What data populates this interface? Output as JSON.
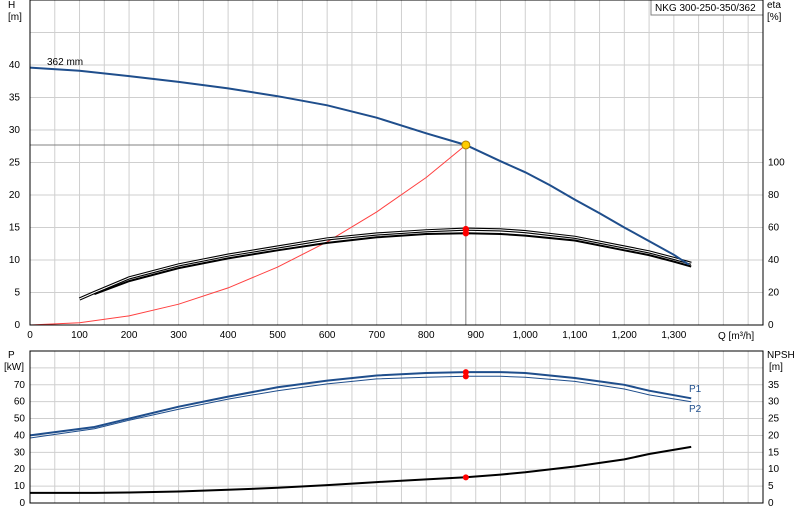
{
  "model_box": {
    "text": "NKG 300-250-350/362"
  },
  "top_chart": {
    "y_left_label": "H",
    "y_left_unit": "[m]",
    "y_right_label": "eta",
    "y_right_unit": "[%]",
    "x_label": "Q [m³/h]",
    "x_ticks": [
      "0",
      "100",
      "200",
      "300",
      "400",
      "500",
      "600",
      "700",
      "800",
      "900",
      "1,000",
      "1,100",
      "1,200",
      "1,300"
    ],
    "y_left_ticks": [
      "0",
      "5",
      "10",
      "15",
      "20",
      "25",
      "30",
      "35",
      "40"
    ],
    "y_right_ticks": [
      "0",
      "20",
      "40",
      "60",
      "80",
      "100"
    ],
    "curve_label": "362 mm"
  },
  "bottom_chart": {
    "y_left_label": "P",
    "y_left_unit": "[kW]",
    "y_right_label": "NPSH",
    "y_right_unit": "[m]",
    "y_left_ticks": [
      "0",
      "10",
      "20",
      "30",
      "40",
      "50",
      "60",
      "70"
    ],
    "y_right_ticks": [
      "0",
      "5",
      "10",
      "15",
      "20",
      "25",
      "30",
      "35"
    ],
    "p1_label": "P1",
    "p2_label": "P2"
  },
  "chart_data": [
    {
      "type": "line",
      "xlim": [
        0,
        1480
      ],
      "ylim": [
        0,
        45
      ],
      "y2lim": [
        0,
        120
      ],
      "duty_point": {
        "q": 880,
        "h": 27.7
      },
      "grid": true,
      "colors": {
        "head": "#1f4e8c",
        "efficiency": "#000000",
        "system": "#ff4040",
        "duty": "#ffcc00",
        "bep": "#ff0000"
      },
      "series": [
        {
          "name": "362 mm",
          "axis": "H",
          "x": [
            0,
            100,
            200,
            300,
            400,
            500,
            600,
            700,
            800,
            880,
            950,
            1000,
            1050,
            1100,
            1150,
            1200,
            1250,
            1300,
            1330
          ],
          "y": [
            39.6,
            39.1,
            38.3,
            37.4,
            36.4,
            35.2,
            33.8,
            31.9,
            29.5,
            27.7,
            25.2,
            23.5,
            21.5,
            19.3,
            17.2,
            15.0,
            12.9,
            10.8,
            9.3
          ]
        },
        {
          "axis": "eta",
          "x": [
            100,
            130,
            200,
            300,
            400,
            500,
            600,
            700,
            800,
            880,
            950,
            1000,
            1100,
            1200,
            1250,
            1300,
            1335
          ],
          "y": [
            16,
            20,
            29,
            37,
            43,
            48,
            53,
            56,
            58,
            59,
            58.5,
            57.5,
            54,
            48,
            45,
            41,
            38
          ]
        },
        {
          "axis": "eta",
          "x": [
            130,
            200,
            300,
            400,
            500,
            600,
            700,
            800,
            880,
            950,
            1000,
            1100,
            1200,
            1250,
            1300,
            1335
          ],
          "y": [
            19,
            27,
            35,
            41,
            46,
            50.5,
            54,
            56,
            56.5,
            56,
            55,
            52,
            46,
            43,
            39,
            36
          ]
        },
        {
          "axis": "H",
          "x": [
            0,
            100,
            200,
            300,
            400,
            500,
            600,
            700,
            800,
            880
          ],
          "y": [
            0,
            0.35,
            1.4,
            3.2,
            5.7,
            8.9,
            12.8,
            17.4,
            22.7,
            27.7
          ]
        }
      ],
      "bep_points": [
        {
          "q": 880,
          "eta": 59
        },
        {
          "q": 880,
          "eta": 56.5
        }
      ]
    },
    {
      "type": "line",
      "xlim": [
        0,
        1480
      ],
      "ylim": [
        0,
        80
      ],
      "y2lim": [
        0,
        40
      ],
      "grid": true,
      "colors": {
        "p1": "#1f4e8c",
        "p2": "#1f4e8c",
        "npsh": "#000000",
        "bep": "#ff0000"
      },
      "series": [
        {
          "name": "P1",
          "axis": "P",
          "x": [
            0,
            130,
            200,
            300,
            400,
            500,
            600,
            700,
            800,
            880,
            950,
            1000,
            1100,
            1200,
            1250,
            1335
          ],
          "y": [
            40,
            45,
            50,
            57,
            63,
            68.5,
            72.5,
            75.5,
            77,
            77.5,
            77.5,
            77,
            74,
            70,
            66.5,
            62
          ]
        },
        {
          "name": "P2",
          "axis": "P",
          "x": [
            0,
            130,
            200,
            300,
            400,
            500,
            600,
            700,
            800,
            880,
            950,
            1000,
            1100,
            1200,
            1250,
            1335
          ],
          "y": [
            38.5,
            44,
            49,
            55.5,
            61.5,
            66.5,
            70.5,
            73.5,
            74.5,
            75,
            75,
            74.5,
            72,
            67.5,
            64,
            60
          ]
        },
        {
          "axis": "NPSH",
          "x": [
            0,
            130,
            200,
            300,
            400,
            500,
            600,
            700,
            800,
            880,
            950,
            1000,
            1100,
            1200,
            1250,
            1335
          ],
          "y": [
            3,
            3,
            3.1,
            3.4,
            3.9,
            4.5,
            5.3,
            6.2,
            7,
            7.6,
            8.4,
            9.1,
            10.8,
            12.9,
            14.5,
            16.6
          ]
        }
      ],
      "bep_points": [
        {
          "q": 880,
          "p": 77.5
        },
        {
          "q": 880,
          "p": 75
        },
        {
          "q": 880,
          "npsh": 7.6
        }
      ]
    }
  ]
}
